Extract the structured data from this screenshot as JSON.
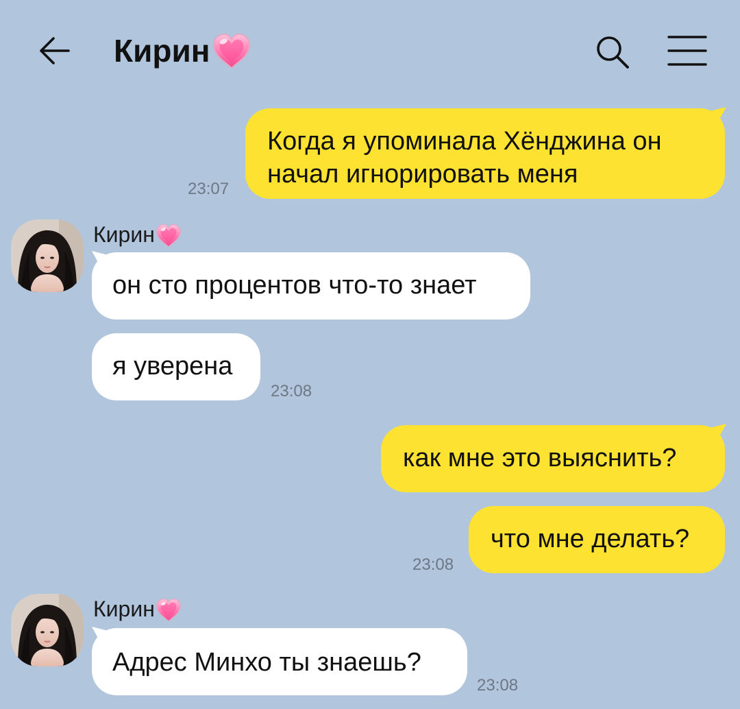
{
  "header": {
    "title": "Кирин",
    "title_emoji": "pink-heart-icon",
    "back_icon": "arrow-left-icon",
    "search_icon": "search-icon",
    "menu_icon": "menu-icon"
  },
  "colors": {
    "background": "#b1c5dd",
    "outgoing_bubble": "#fde232",
    "incoming_bubble": "#ffffff",
    "timestamp": "#6e7784"
  },
  "messages": [
    {
      "direction": "out",
      "lines": [
        "Когда я упоминала Хёнджина он",
        "начал игнорировать меня"
      ],
      "time": "23:07"
    },
    {
      "direction": "in",
      "sender": "Кирин",
      "text": "он сто процентов что-то знает"
    },
    {
      "direction": "in",
      "text": "я уверена",
      "time": "23:08"
    },
    {
      "direction": "out",
      "text": "как мне это выяснить?"
    },
    {
      "direction": "out",
      "text": "что мне делать?",
      "time": "23:08"
    },
    {
      "direction": "in",
      "sender": "Кирин",
      "text": "Адрес Минхо ты знаешь?",
      "time": "23:08"
    }
  ]
}
